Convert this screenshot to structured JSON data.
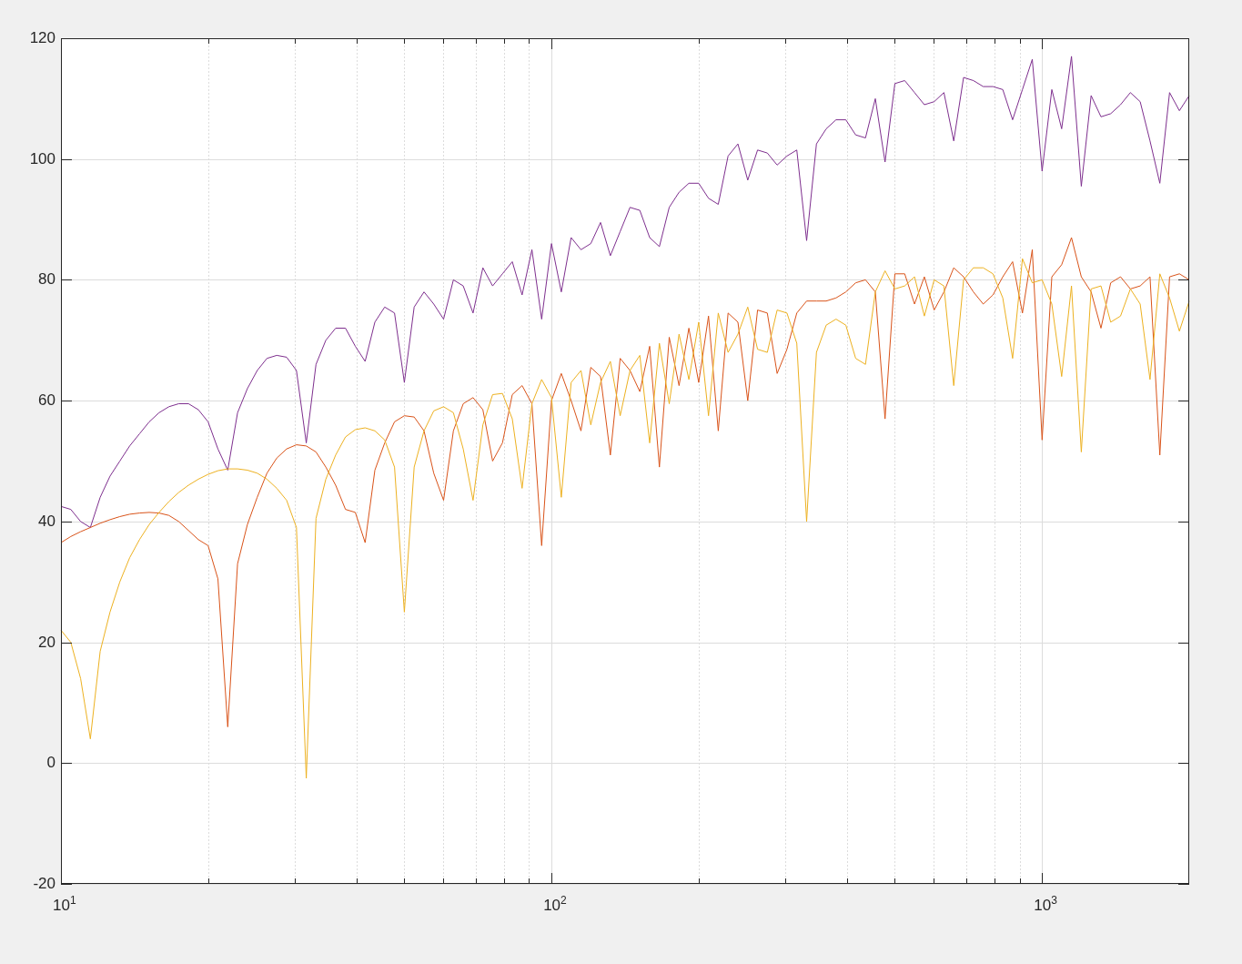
{
  "figure": {
    "chart_data": {
      "type": "line",
      "categories": [
        "10$^{1}$",
        null,
        null,
        null,
        null,
        null,
        null,
        null,
        null,
        null,
        null,
        null,
        null,
        null,
        null,
        null,
        null,
        null,
        null,
        null,
        null,
        null,
        null,
        null,
        null,
        null,
        null,
        null,
        null,
        null,
        null,
        null,
        null,
        null,
        null,
        null,
        null,
        null,
        null,
        null,
        null,
        null,
        null,
        null,
        null,
        null,
        null,
        null,
        null,
        null,
        "10$^{2}$",
        null,
        null,
        null,
        null,
        null,
        null,
        null,
        null,
        null,
        null,
        null,
        null,
        null,
        null,
        null,
        null,
        null,
        null,
        null,
        null,
        null,
        null,
        null,
        null,
        null,
        null,
        null,
        null,
        null,
        null,
        null,
        null,
        null,
        null,
        null,
        null,
        null,
        null,
        null,
        null,
        null,
        null,
        null,
        null,
        null,
        null,
        null,
        null,
        null,
        "10$^{3}$",
        null,
        null,
        null,
        null,
        null,
        null,
        null,
        null,
        null,
        null,
        null,
        null,
        null,
        null,
        null
      ],
      "series": [
        {
          "color": "#7e2f8e",
          "values": [
            42.5,
            42,
            40,
            39,
            44,
            47.5,
            50,
            52.5,
            54.5,
            56.5,
            58,
            59,
            59.5,
            59.5,
            58.5,
            56.5,
            52,
            48.5,
            58,
            62,
            65,
            67,
            67.5,
            67.2,
            65,
            53,
            66,
            70,
            72,
            72,
            69,
            66.5,
            73,
            75.5,
            74.5,
            63,
            75.5,
            78,
            76,
            73.5,
            80,
            79,
            74.5,
            82,
            79,
            81,
            83,
            77.5,
            85,
            73.5,
            86,
            78,
            87,
            85,
            86,
            89.5,
            84,
            88,
            92,
            91.5,
            87,
            85.5,
            92,
            94.5,
            96,
            96,
            93.5,
            92.5,
            100.5,
            102.5,
            96.5,
            101.5,
            101,
            99,
            100.5,
            101.5,
            86.5,
            102.5,
            105,
            106.5,
            106.5,
            104,
            103.5,
            110,
            99.5,
            112.5,
            113,
            111,
            109,
            109.5,
            111,
            103,
            113.5,
            113,
            112,
            112,
            111.5,
            106.5,
            111.5,
            116.5,
            98,
            111.5,
            105,
            117,
            95.5,
            110.5,
            107,
            107.5,
            109,
            111,
            109.5,
            103,
            96,
            111,
            108,
            110.5
          ]
        },
        {
          "color": "#d95319",
          "values": [
            36.5,
            37.5,
            38.3,
            39,
            39.7,
            40.3,
            40.8,
            41.2,
            41.4,
            41.5,
            41.4,
            41,
            40,
            38.5,
            37,
            36,
            30.5,
            6,
            33,
            39.5,
            44,
            48,
            50.5,
            52,
            52.7,
            52.5,
            51.5,
            49,
            46,
            42,
            41.5,
            36.5,
            48.5,
            53,
            56.5,
            57.5,
            57.3,
            55,
            48,
            43.5,
            55,
            59.5,
            60.5,
            58.5,
            50,
            53,
            61,
            62.5,
            59.5,
            36,
            60,
            64.5,
            60,
            55,
            65.5,
            64,
            51,
            67,
            65,
            61.5,
            69,
            49,
            70.5,
            62.5,
            72,
            63,
            74,
            55,
            74.5,
            73,
            60,
            75,
            74.5,
            64.5,
            68.5,
            74.5,
            76.5,
            76.5,
            76.5,
            77,
            78,
            79.5,
            80,
            78,
            57,
            81,
            81,
            76,
            80.5,
            75,
            78,
            82,
            80.5,
            78,
            76,
            77.5,
            80.5,
            83,
            74.5,
            85,
            53.5,
            80.5,
            82.5,
            87,
            80.5,
            78,
            72,
            79.5,
            80.5,
            78.5,
            79,
            80.5,
            51,
            80.5,
            81,
            80
          ]
        },
        {
          "color": "#edb120",
          "values": [
            22,
            20,
            14,
            4,
            18.5,
            25,
            30,
            34,
            37,
            39.5,
            41.5,
            43.3,
            44.8,
            46,
            47,
            47.8,
            48.4,
            48.7,
            48.7,
            48.5,
            48,
            47,
            45.5,
            43.5,
            39,
            -2.5,
            40.5,
            47,
            51,
            54,
            55.2,
            55.5,
            55,
            53.5,
            49,
            25,
            49,
            55,
            58.3,
            59,
            58,
            52,
            43.5,
            56,
            61,
            61.2,
            57,
            45.5,
            59.5,
            63.5,
            60.5,
            44,
            63,
            65,
            56,
            63,
            66.5,
            57.5,
            65,
            67.5,
            53,
            69.5,
            59.5,
            71,
            63.5,
            73,
            57.5,
            74.5,
            68,
            71,
            75.5,
            68.5,
            68,
            75,
            74.5,
            69.5,
            40,
            68,
            72.5,
            73.5,
            72.5,
            67,
            66,
            78,
            81.5,
            78.5,
            79,
            80.5,
            74,
            80,
            79,
            62.5,
            80,
            82,
            82,
            81,
            77,
            67,
            83.5,
            79.5,
            80,
            76,
            64,
            79,
            51.5,
            78.5,
            79,
            73,
            74,
            78.5,
            76,
            63.5,
            81,
            77,
            71.5,
            76.5
          ]
        }
      ],
      "grid": true,
      "ylim": [
        -20,
        120
      ],
      "yticks": [
        -20,
        0,
        20,
        40,
        60,
        80,
        100,
        120
      ]
    }
  }
}
